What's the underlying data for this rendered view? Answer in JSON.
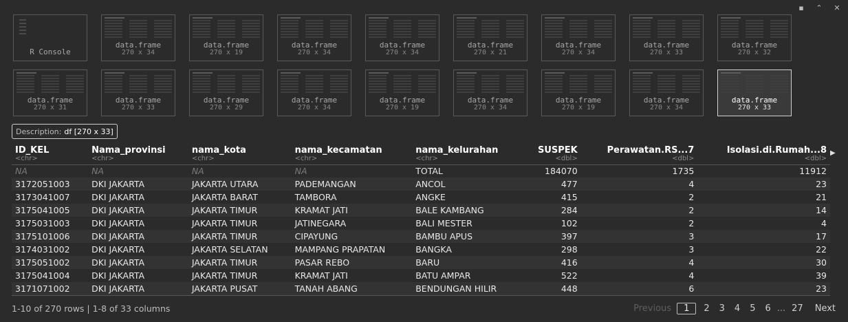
{
  "header_icons": [
    "clear-icon",
    "collapse-icon",
    "close-icon"
  ],
  "thumbnails": {
    "row1": [
      {
        "label": "R Console",
        "sub": ""
      },
      {
        "label": "data.frame",
        "sub": "270 x 34"
      },
      {
        "label": "data.frame",
        "sub": "270 x 19"
      },
      {
        "label": "data.frame",
        "sub": "270 x 34"
      },
      {
        "label": "data.frame",
        "sub": "270 x 34"
      },
      {
        "label": "data.frame",
        "sub": "270 x 21"
      },
      {
        "label": "data.frame",
        "sub": "270 x 34"
      },
      {
        "label": "data.frame",
        "sub": "270 x 33"
      },
      {
        "label": "data.frame",
        "sub": "270 x 32"
      }
    ],
    "row2": [
      {
        "label": "data.frame",
        "sub": "270 x 31"
      },
      {
        "label": "data.frame",
        "sub": "270 x 33"
      },
      {
        "label": "data.frame",
        "sub": "270 x 29"
      },
      {
        "label": "data.frame",
        "sub": "270 x 34"
      },
      {
        "label": "data.frame",
        "sub": "270 x 19"
      },
      {
        "label": "data.frame",
        "sub": "270 x 34"
      },
      {
        "label": "data.frame",
        "sub": "270 x 19"
      },
      {
        "label": "data.frame",
        "sub": "270 x 34"
      },
      {
        "label": "data.frame",
        "sub": "270 x 33"
      }
    ]
  },
  "description": {
    "label": "Description:",
    "value": "df [270 x 33]"
  },
  "table": {
    "columns": [
      {
        "name": "ID_KEL",
        "type": "<chr>"
      },
      {
        "name": "Nama_provinsi",
        "type": "<chr>"
      },
      {
        "name": "nama_kota",
        "type": "<chr>"
      },
      {
        "name": "nama_kecamatan",
        "type": "<chr>"
      },
      {
        "name": "nama_kelurahan",
        "type": "<chr>"
      },
      {
        "name": "SUSPEK",
        "type": "<dbl>"
      },
      {
        "name": "Perawatan.RS...7",
        "type": "<dbl>"
      },
      {
        "name": "Isolasi.di.Rumah...8",
        "type": "<dbl>"
      }
    ],
    "rows": [
      [
        "NA",
        "NA",
        "NA",
        "NA",
        "TOTAL",
        "184070",
        "1735",
        "11912"
      ],
      [
        "3172051003",
        "DKI JAKARTA",
        "JAKARTA UTARA",
        "PADEMANGAN",
        "ANCOL",
        "477",
        "4",
        "23"
      ],
      [
        "3173041007",
        "DKI JAKARTA",
        "JAKARTA BARAT",
        "TAMBORA",
        "ANGKE",
        "415",
        "2",
        "21"
      ],
      [
        "3175041005",
        "DKI JAKARTA",
        "JAKARTA TIMUR",
        "KRAMAT JATI",
        "BALE KAMBANG",
        "284",
        "2",
        "14"
      ],
      [
        "3175031003",
        "DKI JAKARTA",
        "JAKARTA TIMUR",
        "JATINEGARA",
        "BALI MESTER",
        "102",
        "2",
        "4"
      ],
      [
        "3175101006",
        "DKI JAKARTA",
        "JAKARTA TIMUR",
        "CIPAYUNG",
        "BAMBU APUS",
        "397",
        "3",
        "17"
      ],
      [
        "3174031002",
        "DKI JAKARTA",
        "JAKARTA SELATAN",
        "MAMPANG PRAPATAN",
        "BANGKA",
        "298",
        "3",
        "22"
      ],
      [
        "3175051002",
        "DKI JAKARTA",
        "JAKARTA TIMUR",
        "PASAR REBO",
        "BARU",
        "416",
        "4",
        "30"
      ],
      [
        "3175041004",
        "DKI JAKARTA",
        "JAKARTA TIMUR",
        "KRAMAT JATI",
        "BATU AMPAR",
        "522",
        "4",
        "39"
      ],
      [
        "3171071002",
        "DKI JAKARTA",
        "JAKARTA PUSAT",
        "TANAH ABANG",
        "BENDUNGAN HILIR",
        "448",
        "6",
        "23"
      ]
    ]
  },
  "footer": {
    "info": "1-10 of 270 rows | 1-8 of 33 columns",
    "previous": "Previous",
    "current_page": "1",
    "pages": [
      "2",
      "3",
      "4",
      "5",
      "6"
    ],
    "ellipsis": "...",
    "last_page": "27",
    "next": "Next"
  }
}
